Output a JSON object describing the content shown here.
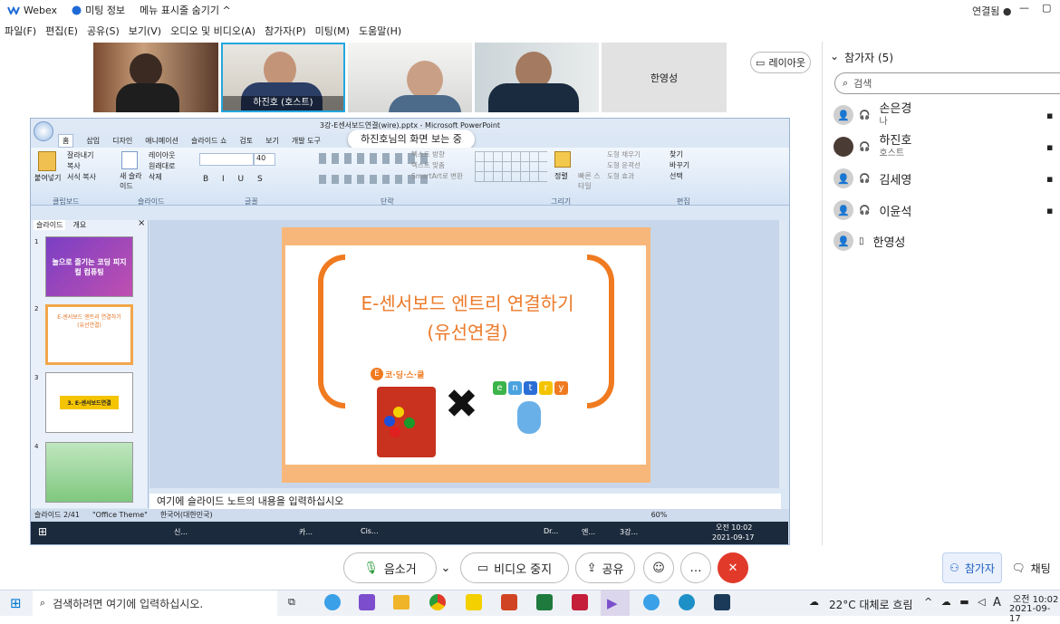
{
  "titlebar": {
    "app": "Webex",
    "meeting_info": "미팅 정보",
    "hide_menu": "메뉴 표시줄 숨기기 ^",
    "status": "연결됨 ●"
  },
  "menubar": [
    "파일(F)",
    "편집(E)",
    "공유(S)",
    "보기(V)",
    "오디오 및 비디오(A)",
    "참가자(P)",
    "미팅(M)",
    "도움말(H)"
  ],
  "videos": [
    {
      "name": ""
    },
    {
      "name": "하진호 (호스트)"
    },
    {
      "name": ""
    },
    {
      "name": ""
    },
    {
      "name": "한영성"
    }
  ],
  "layout_button": "레이아웃",
  "viewing_banner": "하진호님의 화면 보는 중",
  "participants": {
    "title": "참가자 (5)",
    "search_placeholder": "검색",
    "list": [
      {
        "name": "손은경",
        "sub": "나"
      },
      {
        "name": "하진호",
        "sub": "호스트"
      },
      {
        "name": "김세영",
        "sub": ""
      },
      {
        "name": "이윤석",
        "sub": ""
      },
      {
        "name": "한영성",
        "sub": ""
      }
    ]
  },
  "ppt": {
    "title": "3강-E센서보드연결(wire).pptx - Microsoft PowerPoint",
    "tabs": [
      "홈",
      "삽입",
      "디자인",
      "애니메이션",
      "슬라이드 쇼",
      "검토",
      "보기",
      "개발 도구"
    ],
    "groups": [
      "클립보드",
      "슬라이드",
      "글꼴",
      "단락",
      "그리기",
      "편집"
    ],
    "ribbon_items": {
      "paste": "붙여넣기",
      "cut": "잘라내기",
      "copy": "복사",
      "format": "서식 복사",
      "new_slide": "새 슬라이드",
      "layout": "레이아웃",
      "reset": "원래대로",
      "delete": "삭제",
      "font_size": "40",
      "text_dir": "텍스트 방향",
      "text_align": "텍스트 맞춤",
      "smartart": "SmartArt로 변환",
      "arrange": "정렬",
      "quick_style": "빠른 스타일",
      "fill": "도형 채우기",
      "outline": "도형 윤곽선",
      "effect": "도형 효과",
      "find": "찾기",
      "replace": "바꾸기",
      "select": "선택"
    },
    "panel_tabs": [
      "슬라이드",
      "개요"
    ],
    "thumbs": [
      {
        "num": "1",
        "text": "놀으로 즐기는 코딩 피지컬 컴퓨팅"
      },
      {
        "num": "2",
        "text": "E-센서보드 엔트리 연결하기 (유선연결)"
      },
      {
        "num": "3",
        "text": "3. E-센서보드연결"
      },
      {
        "num": "4",
        "text": ""
      }
    ],
    "slide": {
      "line1": "E-센서보드 엔트리 연결하기",
      "line2": "(유선연결)",
      "brand": "코·딩·스·쿨",
      "brand_e": "E",
      "cross": "✖",
      "entry_letters": [
        "e",
        "n",
        "t",
        "r",
        "y"
      ]
    },
    "notes": "여기에 슬라이드 노트의 내용을 입력하십시오",
    "status": {
      "slide": "슬라이드 2/41",
      "theme": "\"Office Theme\"",
      "lang": "한국어(대한민국)",
      "zoom": "60%"
    },
    "taskbar": {
      "items": [
        "신...",
        "카...",
        "Cis...",
        "Dr...",
        "엔...",
        "3강..."
      ],
      "time": "오전 10:02",
      "date": "2021-09-17"
    }
  },
  "controls": {
    "mute": "음소거",
    "video": "비디오 중지",
    "share": "공유",
    "participants": "참가자",
    "chat": "채팅"
  },
  "wtaskbar": {
    "search": "검색하려면 여기에 입력하십시오.",
    "weather": "22°C 대체로 흐림",
    "ime": "A",
    "time": "오전 10:02",
    "date": "2021-09-17"
  }
}
